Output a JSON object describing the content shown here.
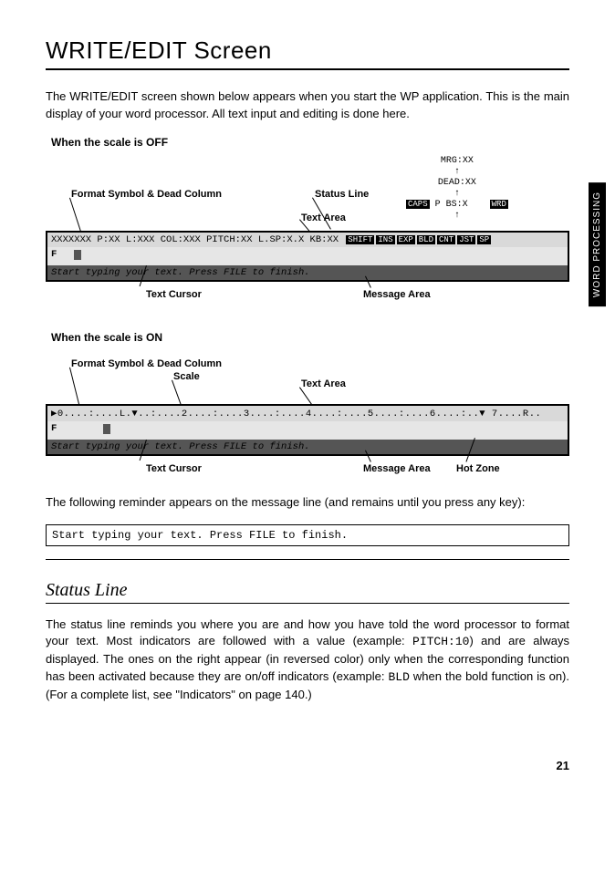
{
  "title": "WRITE/EDIT Screen",
  "intro": "The WRITE/EDIT screen shown below appears when you start the WP application. This is the main display of your word processor. All text input and editing is done here.",
  "side_tab": "WORD PROCESSING",
  "diagram_off": {
    "heading": "When the scale is OFF",
    "stack_top": "MRG:XX",
    "stack_mid": "DEAD:XX",
    "stack_low_caps": "CAPS",
    "stack_low_rest": "P BS:X",
    "stack_low_badge": "WRD",
    "label_format": "Format Symbol & Dead Column",
    "label_status": "Status Line",
    "label_textarea": "Text Area",
    "status_line": "XXXXXXX P:XX L:XXX COL:XXX PITCH:XX L.SP:X.X KB:XX",
    "indicators": [
      "SHIFT",
      "INS",
      "EXP",
      "BLD",
      "CNT",
      "JST",
      "SP"
    ],
    "fmt_symbol": "F",
    "message": "Start typing your text.  Press FILE to finish.",
    "label_cursor": "Text Cursor",
    "label_msgarea": "Message Area"
  },
  "diagram_on": {
    "heading": "When the scale is ON",
    "label_format": "Format Symbol & Dead Column",
    "label_scale": "Scale",
    "label_textarea": "Text Area",
    "scale_bar": "▶0....:....L.▼..:....2....:....3....:....4....:....5....:....6....:..▼ 7....R..",
    "fmt_symbol": "F",
    "message": "Start typing your text.  Press FILE to finish.",
    "label_cursor": "Text Cursor",
    "label_msgarea": "Message Area",
    "label_hotzone": "Hot Zone"
  },
  "reminder_intro": "The following reminder appears on the message line (and remains until you press any key):",
  "reminder_text": "Start typing your text.  Press FILE to finish.",
  "status_heading": "Status Line",
  "status_body_1": "The status line reminds you where you are and how you have told the word processor to format your text. Most indicators are followed with a value (example: ",
  "status_body_mono1": "PITCH:10",
  "status_body_2": ") and are always displayed. The ones on the right appear (in reversed color) only when the corresponding function has been activated because they are on/off indicators (example: ",
  "status_body_mono2": "BLD",
  "status_body_3": " when the bold function is on). (For a complete list, see \"Indicators\" on page 140.)",
  "page_number": "21"
}
